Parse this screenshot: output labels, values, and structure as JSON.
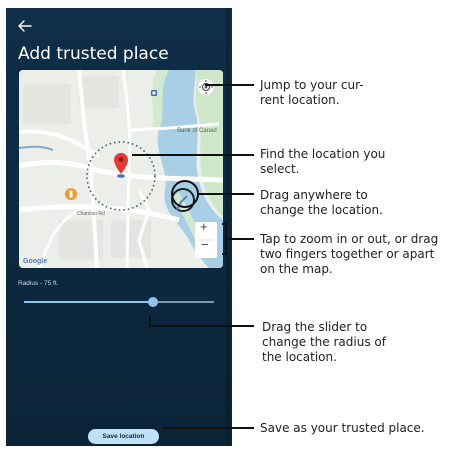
{
  "screen": {
    "title": "Add trusted place",
    "radius_label": "Radius - 75 ft.",
    "save_button": "Save location"
  },
  "map": {
    "poi_label": "Bank of Canad",
    "street_label": "Chamlao Rd",
    "google_logo": "Google",
    "zoom_in": "+",
    "zoom_out": "−",
    "location_icon": "my-location-icon",
    "pin_icon": "map-pin-icon"
  },
  "slider": {
    "value_fraction": 0.68
  },
  "callouts": {
    "jump": [
      "Jump to your cur-",
      "rent location."
    ],
    "find": [
      "Find the location you",
      "select."
    ],
    "drag": [
      "Drag anywhere to",
      "change the location."
    ],
    "zoom": [
      "Tap to zoom in or out, or  drag",
      "two fingers together or apart",
      "on the map."
    ],
    "slider": [
      "Drag the slider to",
      "change the radius of",
      "the location."
    ],
    "save": [
      "Save as your trusted place."
    ]
  },
  "colors": {
    "screen_bg": "#0f2e49",
    "accent": "#8fc3f0",
    "button_bg": "#bfe0f7",
    "pin": "#e53935"
  }
}
